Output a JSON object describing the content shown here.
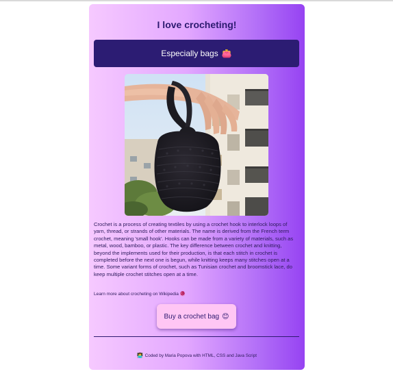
{
  "page": {
    "title": "I love crocheting!",
    "banner_text": "Especially bags",
    "banner_icon": "👛",
    "image_alt": "crochet bag held up in front of a balcony building",
    "description": "Crochet is a process of creating textiles by using a crochet hook to interlock loops of yarn, thread, or strands of other materials. The name is derived from the French term crochet, meaning 'small hook'. Hooks can be made from a variety of materials, such as metal, wood, bamboo, or plastic. The key difference between crochet and knitting, beyond the implements used for their production, is that each stitch in crochet is completed before the next one is begun, while knitting keeps many stitches open at a time. Some variant forms of crochet, such as Tunisian crochet and broomstick lace, do keep multiple crochet stitches open at a time.",
    "learn_more_text": "Learn more about crocheting on Wikipedia",
    "learn_more_icon": "🧶",
    "buy_button_label": "Buy a crochet bag",
    "buy_button_icon": "😊",
    "footer_icon": "👩‍💻",
    "footer_text": "Coded by Maria Popova with HTML, CSS and Java Script"
  },
  "colors": {
    "gradient_start": "#f6c9ff",
    "gradient_end": "#9643f2",
    "banner_bg": "#2c1c73",
    "title_text": "#2c1a6f",
    "button_bg": "#ffc6f4"
  }
}
